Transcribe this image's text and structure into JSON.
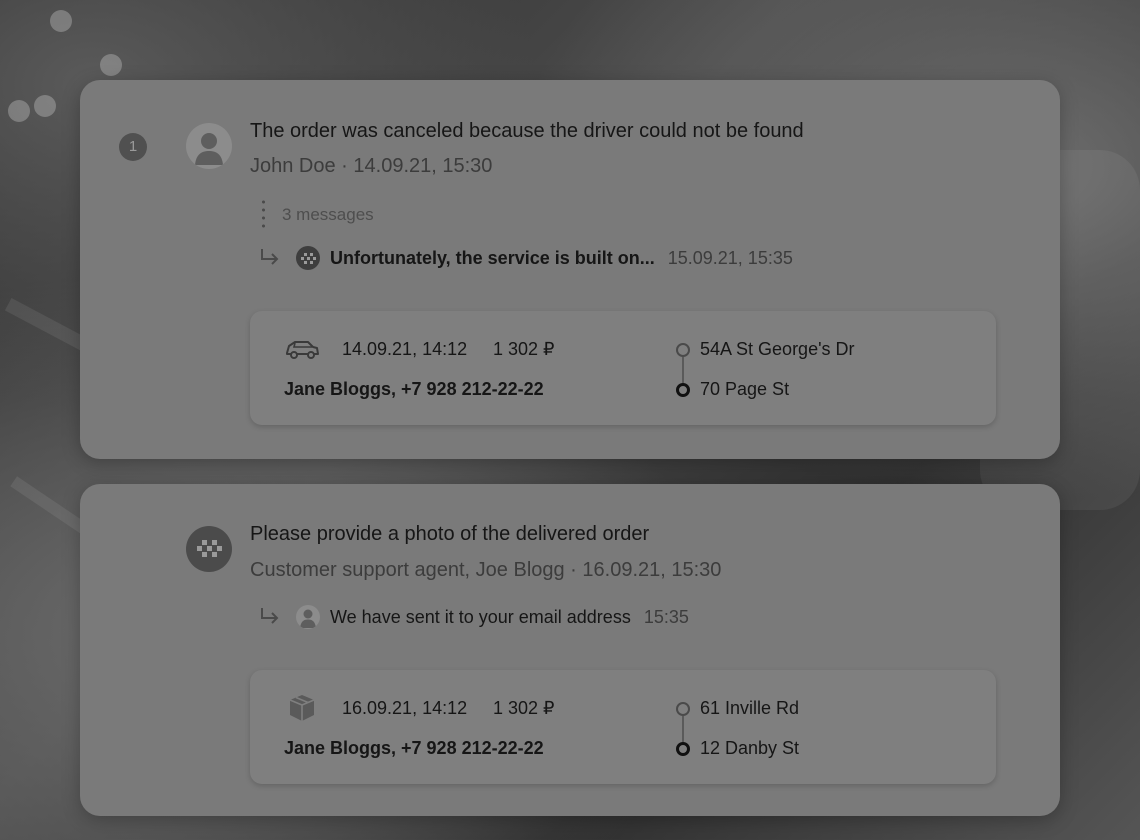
{
  "conversations": [
    {
      "badge_count": "1",
      "title": "The order was canceled because the driver could not be found",
      "meta": "John Doe · 14.09.21, 15:30",
      "avatar_icon": "user-silhouette-icon",
      "thread_count_label": "3 messages",
      "reply": {
        "avatar_icon": "taxi-checker-icon",
        "text": "Unfortunately, the service is built on...",
        "time": "15.09.21, 15:35"
      },
      "order": {
        "icon": "car-icon",
        "datetime": "14.09.21, 14:12",
        "price": "1 302 ₽",
        "contact": "Jane Bloggs, +7 928 212-22-22",
        "from": "54A St George's Dr",
        "to": "70 Page St"
      }
    },
    {
      "title": "Please provide a photo of the delivered order",
      "meta": "Customer support agent, Joe Blogg · 16.09.21, 15:30",
      "avatar_icon": "taxi-checker-icon",
      "reply": {
        "avatar_icon": "user-silhouette-icon",
        "text": "We have sent it to your email address",
        "time": "15:35"
      },
      "order": {
        "icon": "package-box-icon",
        "datetime": "16.09.21, 14:12",
        "price": "1 302 ₽",
        "contact": "Jane Bloggs, +7 928 212-22-22",
        "from": "61 Inville Rd",
        "to": "12 Danby St"
      }
    }
  ]
}
